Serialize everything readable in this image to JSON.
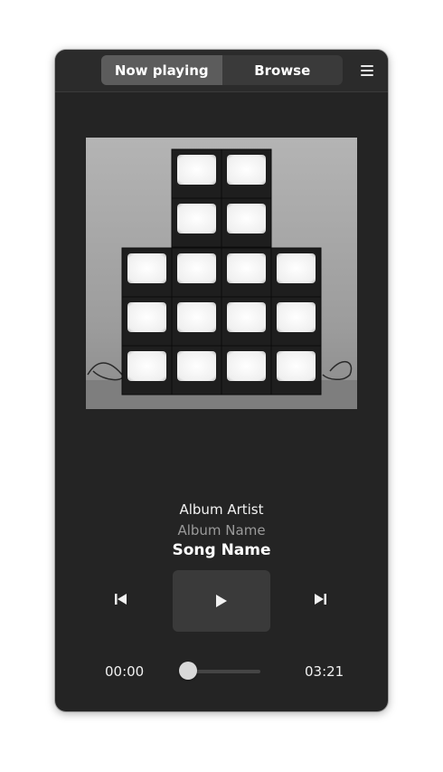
{
  "header": {
    "tabs": [
      {
        "label": "Now playing",
        "active": true
      },
      {
        "label": "Browse",
        "active": false
      }
    ],
    "menu_icon": "hamburger-menu-icon"
  },
  "now_playing": {
    "album_art_icon": "album-art-tv-stack",
    "artist": "Album Artist",
    "album": "Album Name",
    "song": "Song Name"
  },
  "controls": {
    "previous_icon": "skip-previous-icon",
    "play_icon": "play-icon",
    "next_icon": "skip-next-icon"
  },
  "progress": {
    "elapsed": "00:00",
    "duration": "03:21",
    "fraction": 0.0
  },
  "colors": {
    "window_bg": "#242424",
    "header_bg": "#2b2b2b",
    "active_tab": "#5c5c5c",
    "button_bg": "#3a3a3a"
  }
}
